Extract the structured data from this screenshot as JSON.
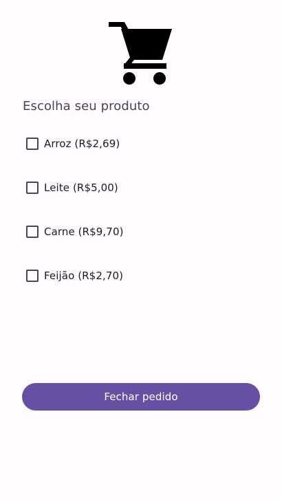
{
  "screen": {
    "background": "#fffbfe"
  },
  "header": {
    "icon": "shopping-cart-icon",
    "title": "Escolha seu produto"
  },
  "products": [
    {
      "label": "Arroz (R$2,69)",
      "checked": false
    },
    {
      "label": "Leite (R$5,00)",
      "checked": false
    },
    {
      "label": "Carne (R$9,70)",
      "checked": false
    },
    {
      "label": "Feijão (R$2,70)",
      "checked": false
    }
  ],
  "action": {
    "label": "Fechar pedido",
    "color": "#6750a4"
  }
}
